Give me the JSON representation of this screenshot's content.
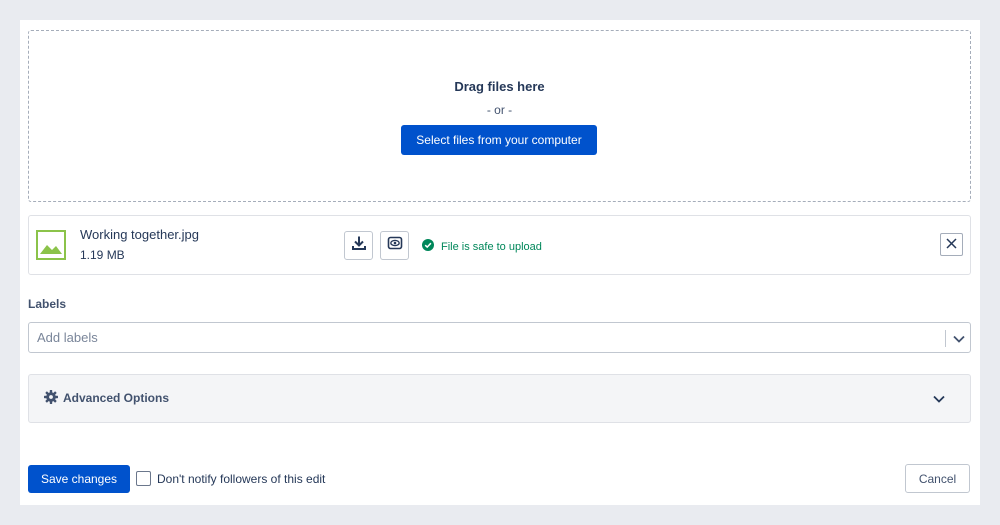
{
  "upload": {
    "drag_text": "Drag files here",
    "or_text": "- or -",
    "select_button": "Select files from your computer"
  },
  "file": {
    "name": "Working together.jpg",
    "size": "1.19 MB",
    "thumb_icon": "image-icon",
    "download_icon": "download-icon",
    "preview_icon": "preview-eye-icon",
    "status_icon": "check-circle-icon",
    "status_text": "File is safe to upload",
    "remove_icon": "close-icon"
  },
  "labels": {
    "heading": "Labels",
    "placeholder": "Add labels",
    "dropdown_icon": "chevron-down-icon"
  },
  "advanced": {
    "icon": "gear-icon",
    "label": "Advanced Options",
    "toggle_icon": "chevron-down-icon"
  },
  "footer": {
    "save_button": "Save changes",
    "notify_label": "Don't notify followers of this edit",
    "notify_checked": false,
    "cancel_button": "Cancel"
  },
  "colors": {
    "primary": "#0052cc",
    "success": "#00875a",
    "image_thumb": "#8bc34a",
    "page_bg": "#e9ebf0"
  }
}
